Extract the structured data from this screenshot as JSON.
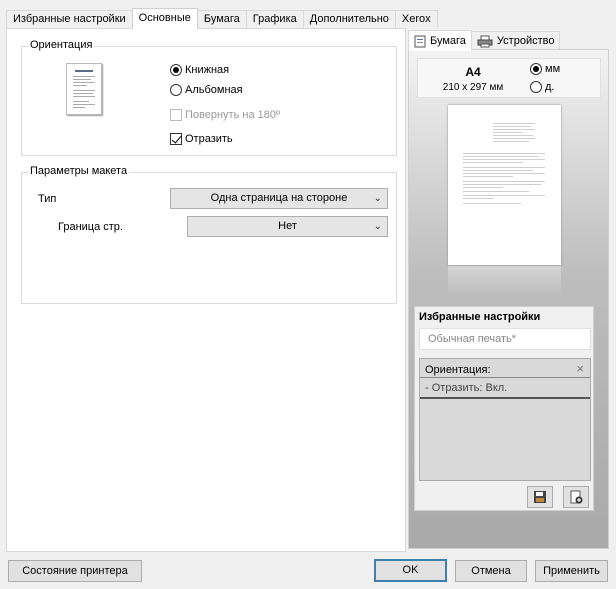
{
  "tabs": [
    "Избранные настройки",
    "Основные",
    "Бумага",
    "Графика",
    "Дополнительно",
    "Xerox"
  ],
  "active_tab": 1,
  "orientation": {
    "title": "Ориентация",
    "portrait_label": "Книжная",
    "landscape_label": "Альбомная",
    "rotate_label": "Повернуть на 180º",
    "mirror_label": "Отразить",
    "portrait_checked": true,
    "mirror_checked": true
  },
  "layout": {
    "title": "Параметры макета",
    "type_label": "Тип",
    "type_value": "Одна страница на стороне",
    "border_label": "Граница стр.",
    "border_value": "Нет"
  },
  "right": {
    "tab_paper": "Бумага",
    "tab_device": "Устройство",
    "paper_size": "A4",
    "paper_dims": "210 x 297 мм",
    "unit_mm": "мм",
    "unit_in": "д.",
    "fav_title": "Избранные настройки",
    "fav_placeholder": "Обычная печать*",
    "fav_item_title": "Ориентация:",
    "fav_item_value": "- Отразить: Вкл."
  },
  "buttons": {
    "printer_status": "Состояние принтера",
    "ok": "OK",
    "cancel": "Отмена",
    "apply": "Применить"
  }
}
